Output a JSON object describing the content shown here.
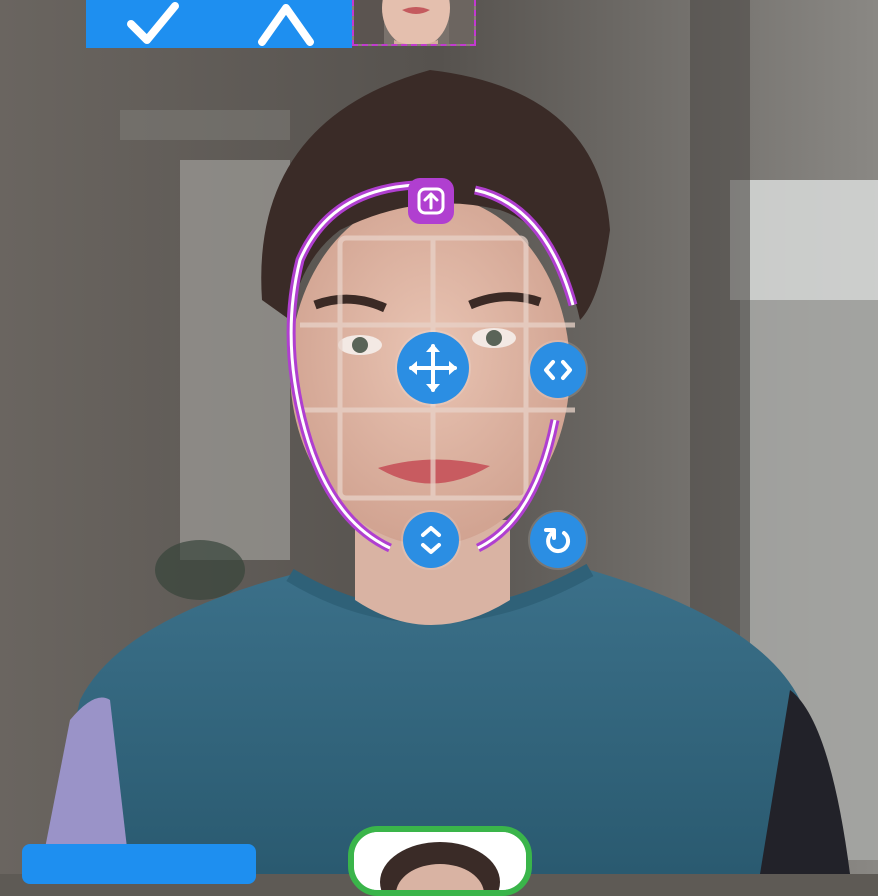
{
  "toolbar": {
    "confirm": "confirm",
    "cancel": "cancel"
  },
  "colors": {
    "accent": "#1e8ff0",
    "control": "#2b8ee3",
    "face_outline": "#b03fd0",
    "thumb_border": "#3ab54a"
  },
  "icons": {
    "confirm": "check-icon",
    "cancel": "chevron-up-icon",
    "move": "move-arrows-icon",
    "width": "horizontal-resize-icon",
    "height": "vertical-resize-icon",
    "rotate": "rotate-icon",
    "top": "arrow-up-icon"
  }
}
